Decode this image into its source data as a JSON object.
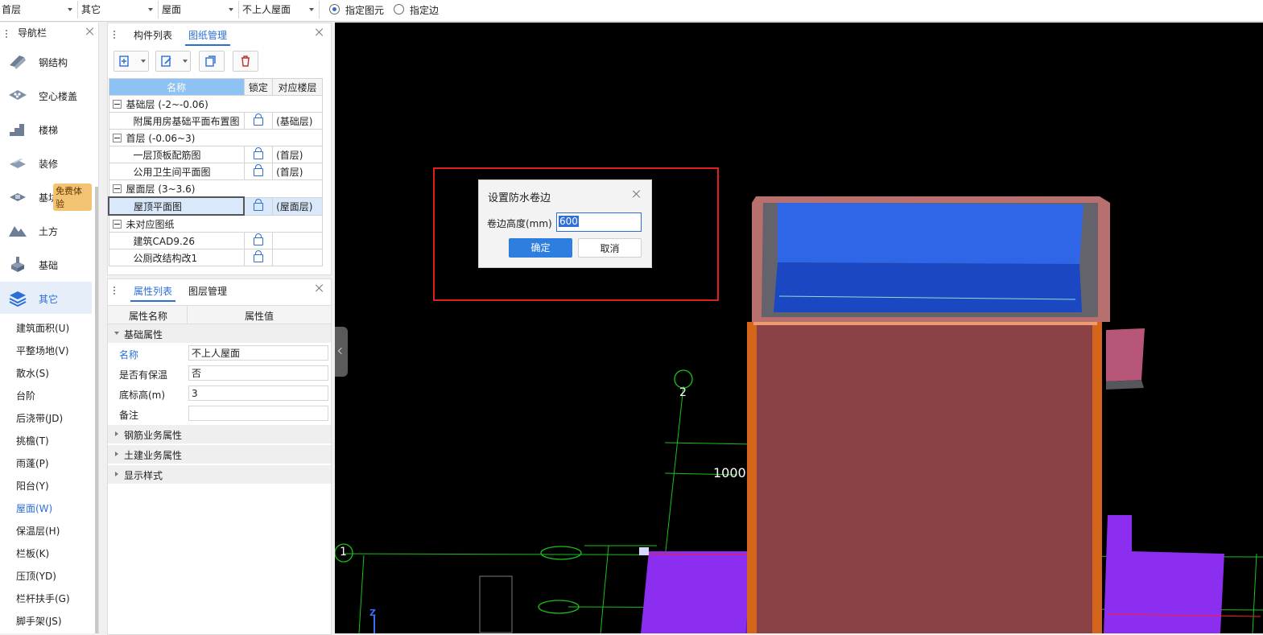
{
  "topbar": {
    "floor": "首层",
    "category": "其它",
    "type": "屋面",
    "component": "不上人屋面",
    "radio_element": "指定图元",
    "radio_edge": "指定边"
  },
  "nav": {
    "title": "导航栏",
    "items": [
      {
        "label": "钢结构",
        "icon": "steel-structure-icon"
      },
      {
        "label": "空心楼盖",
        "icon": "hollow-floor-icon"
      },
      {
        "label": "楼梯",
        "icon": "stairs-icon"
      },
      {
        "label": "装修",
        "icon": "decoration-icon"
      },
      {
        "label": "基坑支护",
        "icon": "foundation-pit-icon"
      },
      {
        "label": "土方",
        "icon": "earthwork-icon"
      },
      {
        "label": "基础",
        "icon": "foundation-icon"
      },
      {
        "label": "其它",
        "icon": "other-layers-icon"
      }
    ],
    "badge": "免费体验",
    "sub_items": [
      "建筑面积(U)",
      "平整场地(V)",
      "散水(S)",
      "台阶",
      "后浇带(JD)",
      "挑檐(T)",
      "雨蓬(P)",
      "阳台(Y)",
      "屋面(W)",
      "保温层(H)",
      "栏板(K)",
      "压顶(YD)",
      "栏杆扶手(G)",
      "脚手架(JS)"
    ]
  },
  "drawing_panel": {
    "tab_components": "构件列表",
    "tab_drawings": "图纸管理",
    "columns": [
      "名称",
      "锁定",
      "对应楼层"
    ],
    "rows": [
      {
        "name": "基础层 (-2~-0.06)",
        "group": true
      },
      {
        "name": "附属用房基础平面布置图",
        "floor": "(基础层)"
      },
      {
        "name": "首层 (-0.06~3)",
        "group": true
      },
      {
        "name": "一层顶板配筋图",
        "floor": "(首层)"
      },
      {
        "name": "公用卫生间平面图",
        "floor": "(首层)"
      },
      {
        "name": "屋面层 (3~3.6)",
        "group": true
      },
      {
        "name": "屋顶平面图",
        "floor": "(屋面层)"
      },
      {
        "name": "未对应图纸",
        "group": true
      },
      {
        "name": "建筑CAD9.26",
        "floor": ""
      },
      {
        "name": "公厕改结构改1",
        "floor": ""
      }
    ]
  },
  "props_panel": {
    "tab_props": "属性列表",
    "tab_layers": "图层管理",
    "col_name": "属性名称",
    "col_value": "属性值",
    "group_basic": "基础属性",
    "rows": [
      {
        "k": "名称",
        "v": "不上人屋面"
      },
      {
        "k": "是否有保温",
        "v": "否"
      },
      {
        "k": "底标高(m)",
        "v": "3"
      },
      {
        "k": "备注",
        "v": ""
      }
    ],
    "groups": [
      "钢筋业务属性",
      "土建业务属性",
      "显示样式"
    ]
  },
  "dialog": {
    "title": "设置防水卷边",
    "field_label": "卷边高度(mm)",
    "field_value": "600",
    "ok": "确定",
    "cancel": "取消"
  },
  "viewport": {
    "axis_1": "1",
    "axis_2": "2",
    "dimension": "1000",
    "z_axis": "Z"
  }
}
